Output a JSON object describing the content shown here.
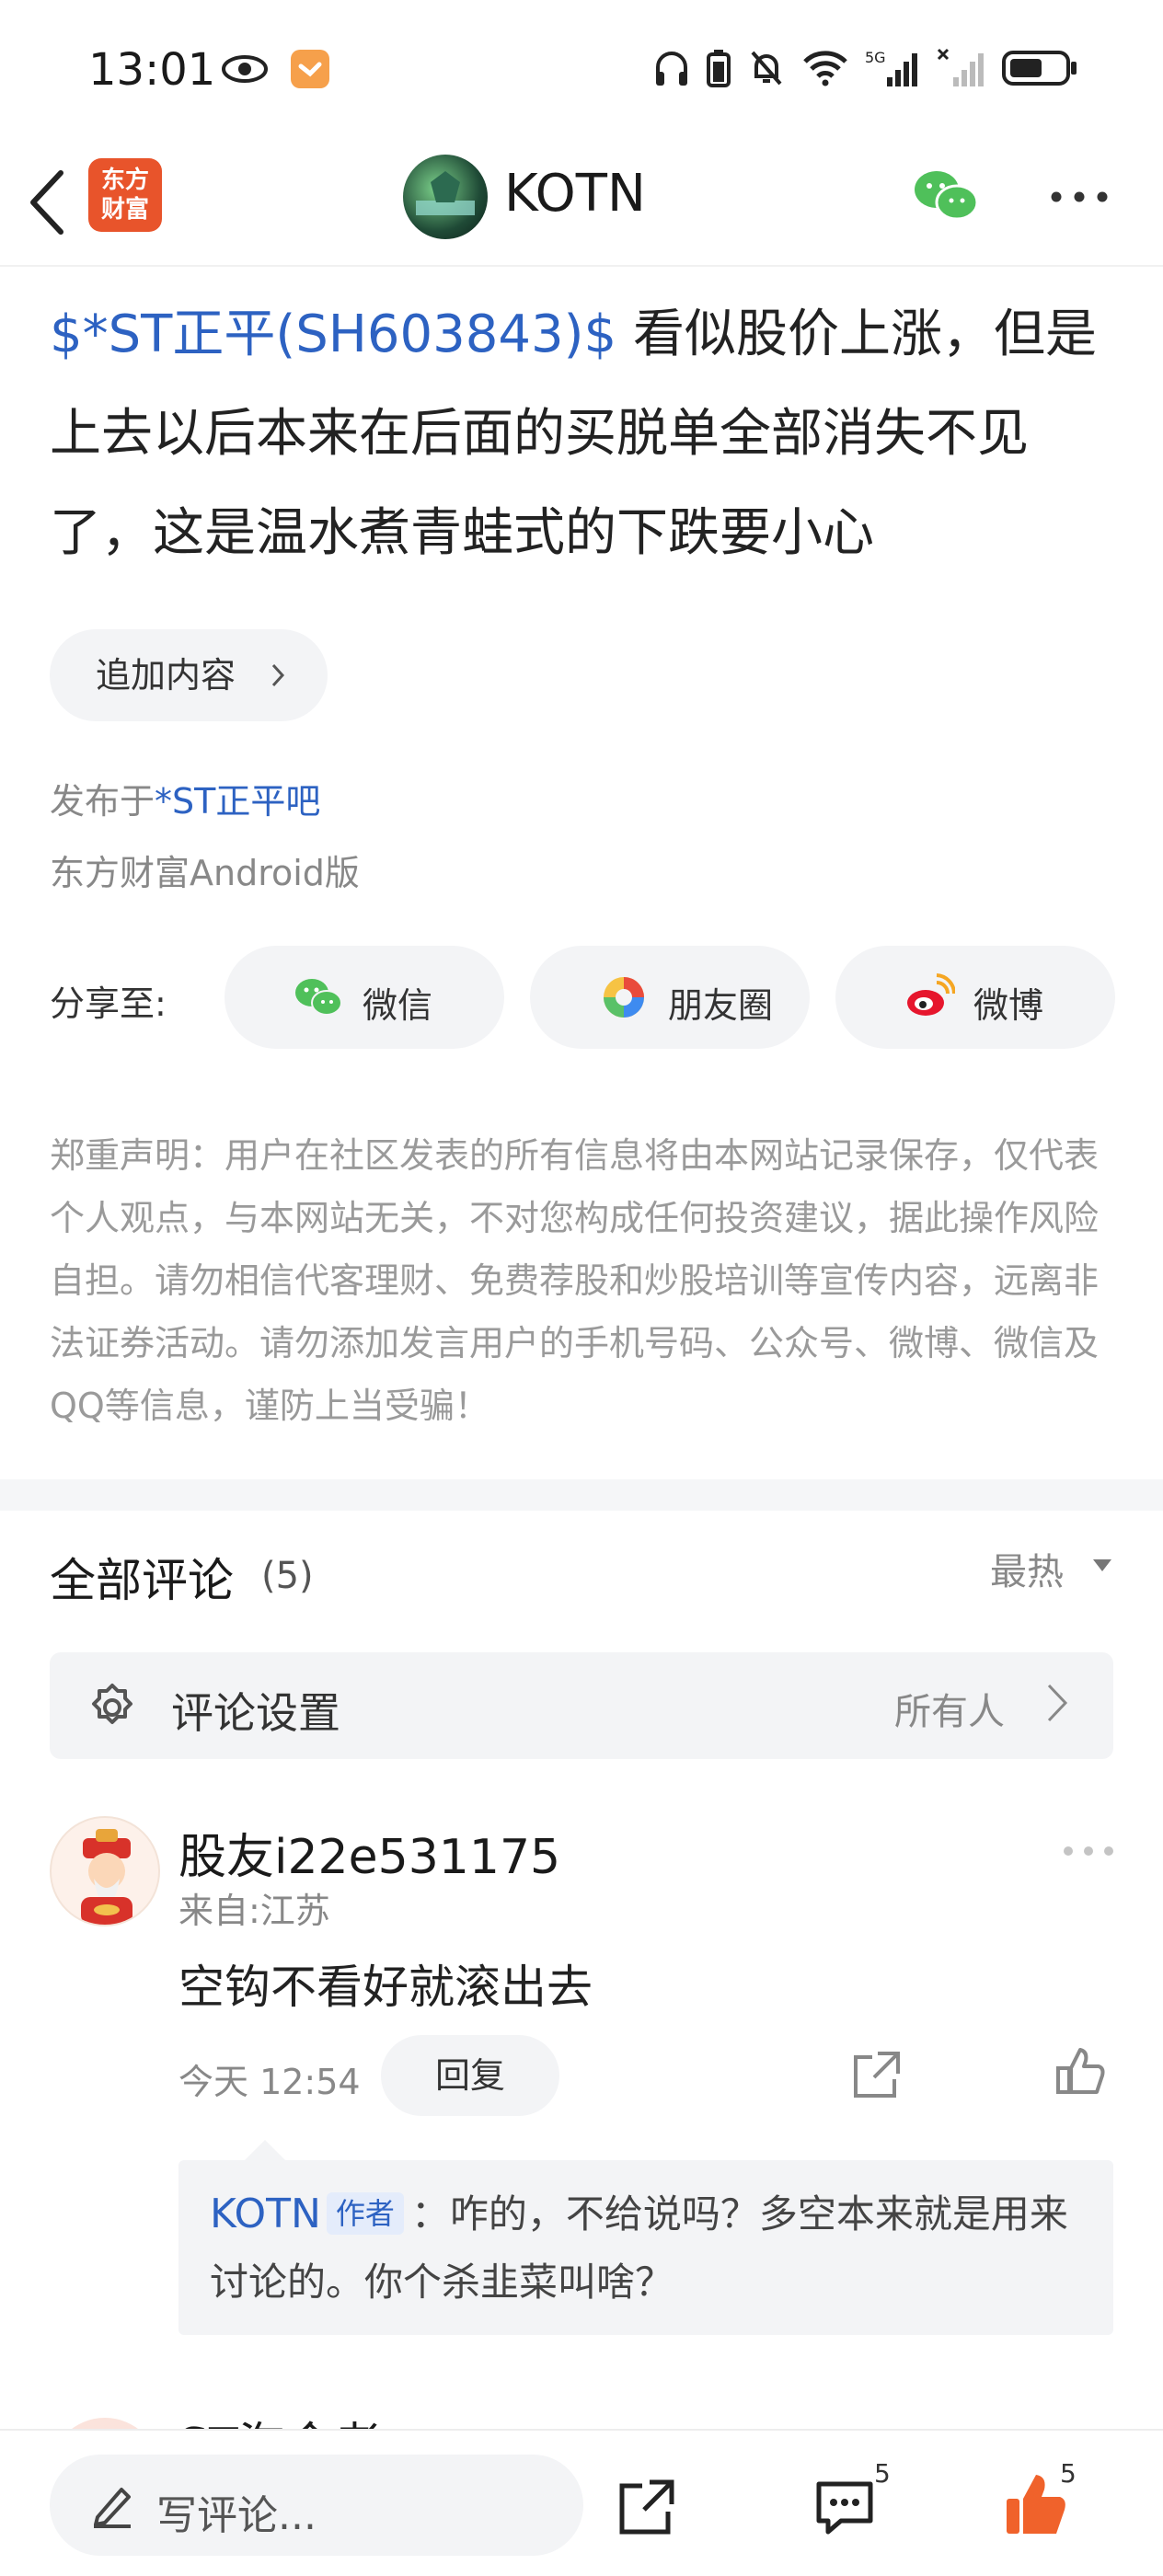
{
  "status_bar": {
    "time": "13:01",
    "network": "5G"
  },
  "nav": {
    "logo_text_line1": "东方",
    "logo_text_line2": "财富",
    "title": "KOTN"
  },
  "post": {
    "stock_link": "$*ST正平(SH603843)$",
    "body": " 看似股价上涨，但是上去以后本来在后面的买脱单全部消失不见了，这是温水煮青蛙式的下跌要小心",
    "append_label": "追加内容",
    "published_prefix": "发布于",
    "published_bar": "*ST正平吧",
    "client": "东方财富Android版"
  },
  "share": {
    "label": "分享至:",
    "wechat": "微信",
    "moments": "朋友圈",
    "weibo": "微博"
  },
  "disclaimer": "郑重声明：用户在社区发表的所有信息将由本网站记录保存，仅代表个人观点，与本网站无关，不对您构成任何投资建议，据此操作风险自担。请勿相信代客理财、免费荐股和炒股培训等宣传内容，远离非法证券活动。请勿添加发言用户的手机号码、公众号、微博、微信及QQ等信息，谨防上当受骗！",
  "comments": {
    "title": "全部评论",
    "count": "(5)",
    "sort": "最热",
    "settings_label": "评论设置",
    "settings_value": "所有人",
    "items": [
      {
        "user": "股友i22e531175",
        "location": "来自:江苏",
        "text": "空钩不看好就滚出去",
        "time": "今天 12:54",
        "reply_label": "回复",
        "sub_reply": {
          "user": "KOTN",
          "tag": "作者",
          "text": "：咋的，不给说吗？多空本来就是用来讨论的。你个杀韭菜叫啥？"
        }
      }
    ],
    "next_user_peek": "ST淘金者"
  },
  "bottom_bar": {
    "write_placeholder": "写评论...",
    "comment_count": "5",
    "like_count": "5"
  },
  "colors": {
    "link_blue": "#2d62c2",
    "brand_orange": "#e8542b",
    "like_orange": "#f0622b",
    "wechat_green": "#4fc05a"
  }
}
